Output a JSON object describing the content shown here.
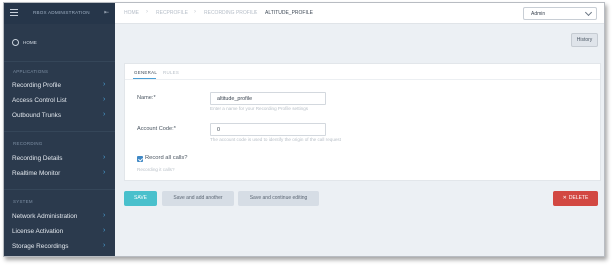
{
  "sidebar": {
    "brand": "RBOX ADMINISTRATION",
    "home_label": "HOME",
    "sections": {
      "applications": "APPLICATIONS",
      "recording": "RECORDING",
      "system": "SYSTEM"
    },
    "applications": [
      "Recording Profile",
      "Access Control List",
      "Outbound Trunks"
    ],
    "recording": [
      "Recording Details",
      "Realtime Monitor"
    ],
    "system": [
      "Network Administration",
      "License Activation",
      "Storage Recordings"
    ]
  },
  "breadcrumb": [
    "HOME",
    "RECPROFILE",
    "RECORDING PROFILE",
    "ALTITUDE_PROFILE"
  ],
  "user_menu": {
    "value": "Admin"
  },
  "history_label": "History",
  "tabs": [
    "GENERAL",
    "RULES"
  ],
  "form": {
    "name": {
      "label": "Name:*",
      "value": "altitude_profile",
      "hint": "Enter a name for your Recording Profile settings"
    },
    "account_code": {
      "label": "Account Code:*",
      "value": "0",
      "hint": "The account code is used to identify the origin of the call request"
    },
    "record_all": {
      "label": "Record all calls?",
      "hint": "Recording it calls?",
      "checked": true
    }
  },
  "buttons": {
    "save": "SAVE",
    "save_add": "Save and add another",
    "save_continue": "Save and continue editing",
    "delete": "DELETE"
  },
  "colors": {
    "sidebar": "#2b3a4d",
    "accent": "#49c0cc",
    "danger": "#d24842",
    "chevron": "#4aa3d9"
  }
}
